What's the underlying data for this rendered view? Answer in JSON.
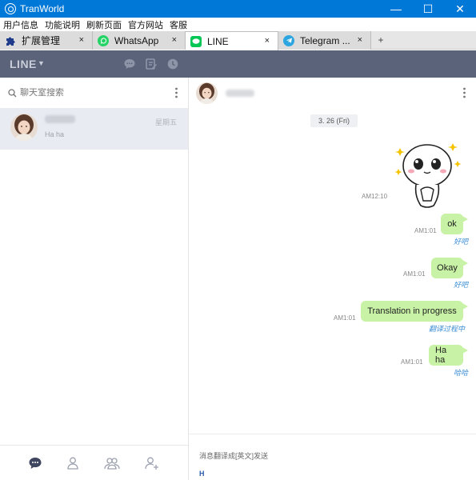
{
  "window": {
    "title": "TranWorld",
    "minimize": "—",
    "maximize": "☐",
    "close": "✕"
  },
  "menu": {
    "items": [
      "用户信息",
      "功能说明",
      "刷新页面",
      "官方网站",
      "客服"
    ]
  },
  "tabs": [
    {
      "label": "扩展管理",
      "icon": "puzzle-icon",
      "color": "#1f3b8c",
      "close": "×"
    },
    {
      "label": "WhatsApp",
      "icon": "whatsapp-icon",
      "color": "#25d366",
      "close": "×"
    },
    {
      "label": "LINE",
      "icon": "line-icon",
      "color": "#06c755",
      "close": "×",
      "active": true
    },
    {
      "label": "Telegram ...",
      "icon": "telegram-icon",
      "color": "#2ca5e0",
      "close": "×"
    }
  ],
  "tab_add": "+",
  "line_header": {
    "logo": "LINE",
    "caret": "▼"
  },
  "sidebar": {
    "search_placeholder": "聊天室搜索",
    "chat": {
      "date": "星期五",
      "preview": "Ha ha"
    }
  },
  "chat": {
    "date_chip": "3. 26 (Fri)",
    "sticker_time": "AM12:10",
    "messages": [
      {
        "text": "ok",
        "time": "AM1:01",
        "translation": "好吧"
      },
      {
        "text": "Okay",
        "time": "AM1:01",
        "translation": "好吧"
      },
      {
        "text": "Translation in progress",
        "time": "AM1:01",
        "translation": "翻译过程中"
      },
      {
        "text": "Ha ha",
        "time": "AM1:01",
        "translation": "哈哈"
      }
    ],
    "composer_hint": "消息翻译成[英文]发送",
    "composer_text": "H"
  },
  "colors": {
    "title_bar": "#0078d7",
    "line_header": "#5a637a",
    "bubble": "#c8f2a6",
    "translation": "#3d8ed6"
  }
}
